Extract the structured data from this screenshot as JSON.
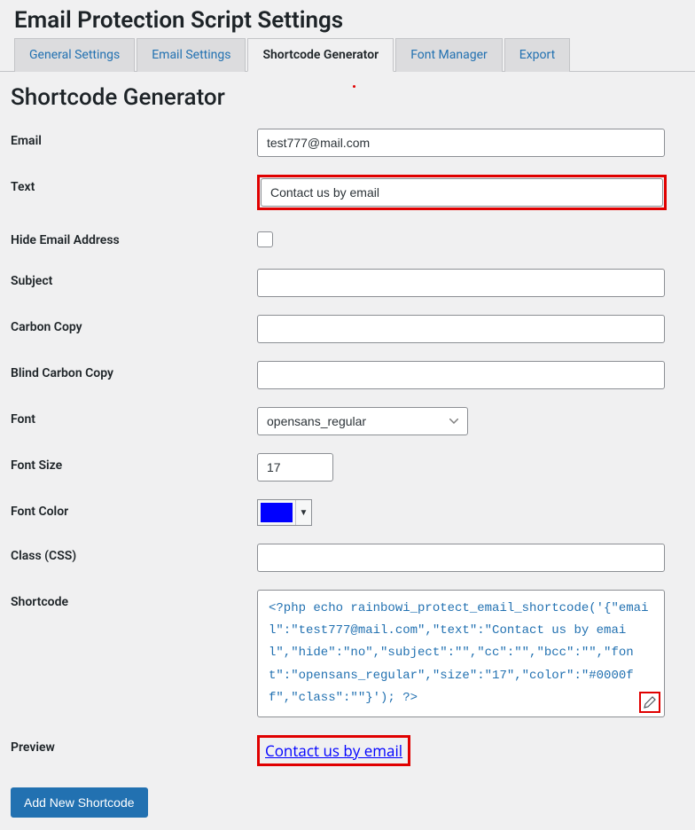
{
  "page_title": "Email Protection Script Settings",
  "tabs": [
    {
      "label": "General Settings",
      "active": false
    },
    {
      "label": "Email Settings",
      "active": false
    },
    {
      "label": "Shortcode Generator",
      "active": true
    },
    {
      "label": "Font Manager",
      "active": false
    },
    {
      "label": "Export",
      "active": false
    }
  ],
  "section_title": "Shortcode Generator",
  "form": {
    "email": {
      "label": "Email",
      "value": "test777@mail.com"
    },
    "text": {
      "label": "Text",
      "value": "Contact us by email"
    },
    "hide": {
      "label": "Hide Email Address",
      "checked": false
    },
    "subject": {
      "label": "Subject",
      "value": ""
    },
    "cc": {
      "label": "Carbon Copy",
      "value": ""
    },
    "bcc": {
      "label": "Blind Carbon Copy",
      "value": ""
    },
    "font": {
      "label": "Font",
      "value": "opensans_regular"
    },
    "font_size": {
      "label": "Font Size",
      "value": "17"
    },
    "font_color": {
      "label": "Font Color",
      "value": "#0000ff"
    },
    "css_class": {
      "label": "Class (CSS)",
      "value": ""
    },
    "shortcode": {
      "label": "Shortcode",
      "value": "<?php echo rainbowi_protect_email_shortcode('{\"email\":\"test777@mail.com\",\"text\":\"Contact us by email\",\"hide\":\"no\",\"subject\":\"\",\"cc\":\"\",\"bcc\":\"\",\"font\":\"opensans_regular\",\"size\":\"17\",\"color\":\"#0000ff\",\"class\":\"\"}'); ?>"
    },
    "preview": {
      "label": "Preview",
      "link_text": "Contact us by email"
    }
  },
  "button": {
    "add_shortcode": "Add New Shortcode"
  }
}
